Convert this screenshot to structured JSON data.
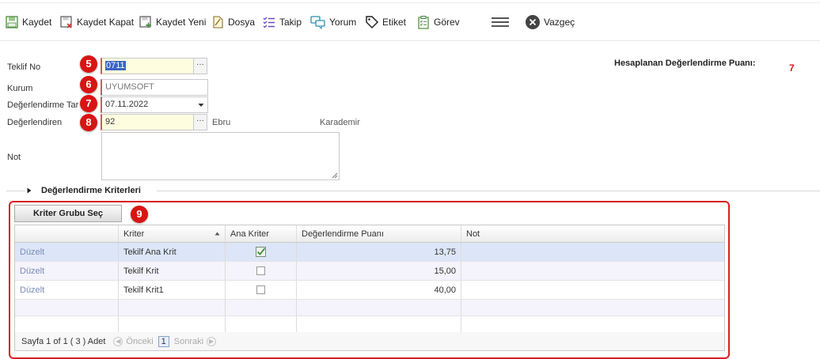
{
  "toolbar": {
    "kaydet": "Kaydet",
    "kaydet_kapat": "Kaydet Kapat",
    "kaydet_yeni": "Kaydet Yeni",
    "dosya": "Dosya",
    "takip": "Takip",
    "yorum": "Yorum",
    "etiket": "Etiket",
    "gorev": "Görev",
    "vazgec": "Vazgeç"
  },
  "form": {
    "teklif_no_label": "Teklif No",
    "teklif_no_value": "0711",
    "kurum_label": "Kurum",
    "kurum_value": "UYUMSOFT",
    "tarih_label": "Değerlendirme Tar",
    "tarih_value": "07.11.2022",
    "degerlendiren_label": "Değerlendiren",
    "degerlendiren_value": "92",
    "degerlendiren_first": "Ebru",
    "degerlendiren_last": "Karademir",
    "not_label": "Not",
    "not_value": ""
  },
  "score": {
    "label": "Hesaplanan Değerlendirme Puanı:",
    "value": "7"
  },
  "section": {
    "title": "Değerlendirme Kriterleri"
  },
  "badges": [
    "5",
    "6",
    "7",
    "8",
    "9"
  ],
  "grid": {
    "button": "Kriter Grubu Seç",
    "headers": [
      "",
      "Kriter",
      "Ana Kriter",
      "Değerlendirme Puanı",
      "Not"
    ],
    "rows": [
      {
        "action": "Düzelt",
        "kriter": "Tekilf Ana Krit",
        "ana": true,
        "puan": "13,75",
        "not": ""
      },
      {
        "action": "Düzelt",
        "kriter": "Tekilf Krit",
        "ana": false,
        "puan": "15,00",
        "not": ""
      },
      {
        "action": "Düzelt",
        "kriter": "Tekilf Krit1",
        "ana": false,
        "puan": "40,00",
        "not": ""
      }
    ]
  },
  "pager": {
    "info": "Sayfa 1 of 1 ( 3 ) Adet",
    "prev": "Önceki",
    "page": "1",
    "next": "Sonraki"
  },
  "colors": {
    "badge": "#d91414",
    "highlight_border": "#d62020",
    "score_value": "#d91414",
    "selected_row": "#dde6f8"
  }
}
